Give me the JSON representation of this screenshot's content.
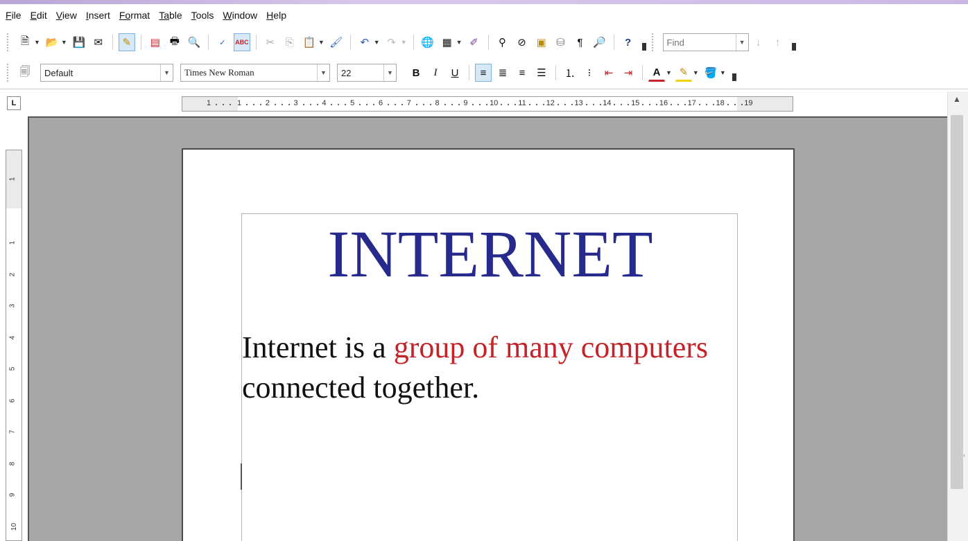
{
  "menubar": {
    "items": [
      {
        "u": "F",
        "rest": "ile"
      },
      {
        "u": "E",
        "rest": "dit"
      },
      {
        "u": "V",
        "rest": "iew"
      },
      {
        "u": "I",
        "rest": "nsert"
      },
      {
        "u": "Fo",
        "rest": "rmat"
      },
      {
        "u": "Ta",
        "rest": "ble"
      },
      {
        "u": "T",
        "rest": "ools"
      },
      {
        "u": "W",
        "rest": "indow"
      },
      {
        "u": "H",
        "rest": "elp"
      }
    ]
  },
  "toolbar": {
    "find_placeholder": "Find",
    "paragraph_style": "Default",
    "font_name": "Times New Roman",
    "font_size": "22",
    "bold_label": "B",
    "italic_label": "I",
    "underline_label": "U",
    "font_color_label": "A",
    "colors": {
      "font_color": "#c4232a",
      "highlight": "#f2d20c",
      "active_button_bg": "#d7e8f7"
    }
  },
  "ruler": {
    "tab_selector": "L",
    "horizontal_ticks": [
      "1",
      "1",
      "2",
      "3",
      "4",
      "5",
      "6",
      "7",
      "8",
      "9",
      "10",
      "11",
      "12",
      "13",
      "14",
      "15",
      "16",
      "17",
      "18",
      "19"
    ],
    "vertical_ticks": [
      "1",
      "1",
      "2",
      "3",
      "4",
      "5",
      "6",
      "7",
      "8",
      "9",
      "10"
    ]
  },
  "document": {
    "title": "INTERNET",
    "title_color": "#262a8c",
    "body_part1": "Internet is a ",
    "body_highlight": "group of many computers",
    "body_highlight_color": "#c4232a",
    "body_part2": "connected together."
  }
}
